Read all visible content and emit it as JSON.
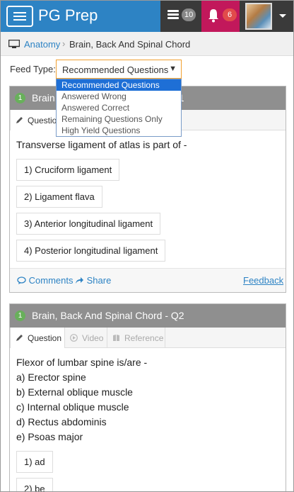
{
  "app": {
    "title": "PG Prep"
  },
  "topbar": {
    "news_badge": "10",
    "notif_badge": "6"
  },
  "breadcrumb": {
    "parent": "Anatomy",
    "separator": "›",
    "current": "Brain, Back And Spinal Chord"
  },
  "feed": {
    "label": "Feed Type:",
    "selected": "Recommended Questions",
    "options": [
      "Recommended Questions",
      "Answered Wrong",
      "Answered Correct",
      "Remaining Questions Only",
      "High Yield Questions"
    ]
  },
  "questions": [
    {
      "number": "1",
      "title": "Brain, Back And Spinal Chord - Q1",
      "tabs": [
        "Question",
        "Video",
        "Reference"
      ],
      "text": "Transverse ligament of atlas is part of -",
      "statements": [],
      "options": [
        "1) Cruciform ligament",
        "2) Ligament flava",
        "3) Anterior longitudinal ligament",
        "4) Posterior longitudinal ligament"
      ],
      "footer": {
        "comments": "Comments",
        "share": "Share",
        "feedback": "Feedback"
      }
    },
    {
      "number": "1",
      "title": "Brain, Back And Spinal Chord - Q2",
      "tabs": [
        "Question",
        "Video",
        "Reference"
      ],
      "text": "Flexor of lumbar spine is/are -",
      "statements": [
        "a) Erector spine",
        "b) External oblique muscle",
        "c) Internal oblique muscle",
        "d) Rectus abdominis",
        "e) Psoas major"
      ],
      "options": [
        "1) ad",
        "2) be"
      ]
    }
  ],
  "colors": {
    "brand": "#2d83c4",
    "notif": "#c2185b",
    "card_header": "#8f8f8f",
    "highlight": "#1e6fd6"
  }
}
